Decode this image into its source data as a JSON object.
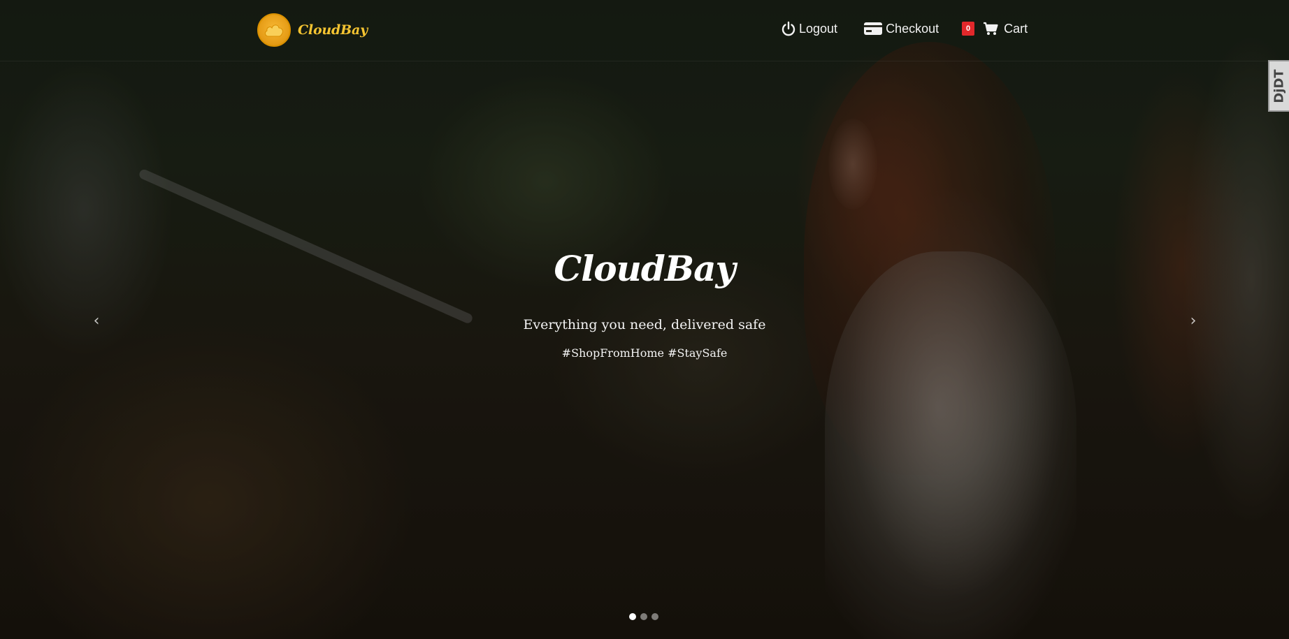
{
  "brand": {
    "name": "CloudBay",
    "logo_icon": "cloud-icon",
    "accent": "#f5c431"
  },
  "nav": {
    "logout": {
      "label": "Logout",
      "icon": "power-icon"
    },
    "checkout": {
      "label": "Checkout",
      "icon": "credit-card-icon"
    },
    "cart": {
      "label": "Cart",
      "icon": "shopping-cart-icon",
      "count": "0",
      "badge_color": "#e2282b"
    }
  },
  "hero": {
    "title": "CloudBay",
    "subtitle": "Everything you need, delivered safe",
    "tags": "#ShopFromHome #StaySafe",
    "prev_icon": "chevron-left-icon",
    "next_icon": "chevron-right-icon",
    "prev_glyph": "‹",
    "next_glyph": "›",
    "slides": 3,
    "active_slide": 1
  },
  "side_tab": {
    "label": "DjDT"
  }
}
